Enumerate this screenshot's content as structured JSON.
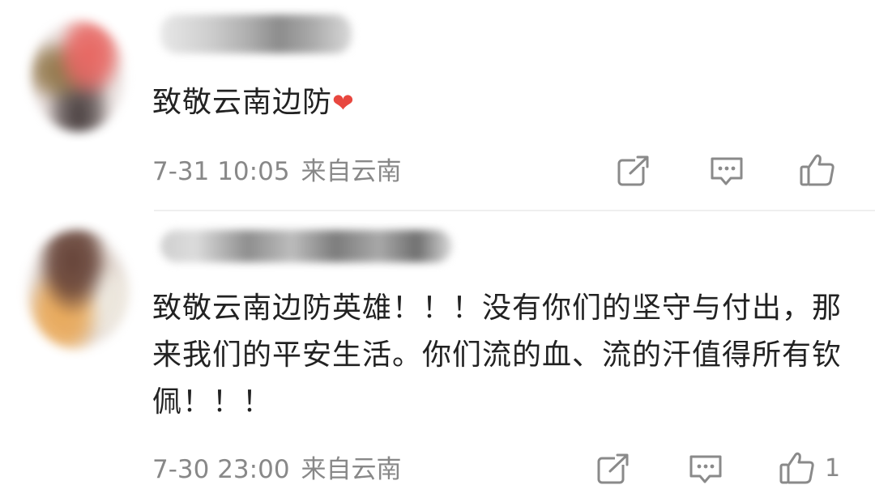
{
  "comments": [
    {
      "text": "致敬云南边防",
      "emoji": "❤",
      "time": "7-31 10:05",
      "location": "来自云南",
      "like_count": ""
    },
    {
      "text": "致敬云南边防英雄！！！没有你们的坚守与付出，那来我们的平安生活。你们流的血、流的汗值得所有钦佩！！！",
      "time": "7-30 23:00",
      "location": "来自云南",
      "like_count": "1"
    }
  ],
  "colors": {
    "text": "#222222",
    "meta": "#888888",
    "heart": "#e8473f",
    "divider": "#efefef"
  },
  "icons": {
    "share": "share-icon",
    "reply": "comment-icon",
    "like": "thumbs-up-icon"
  }
}
